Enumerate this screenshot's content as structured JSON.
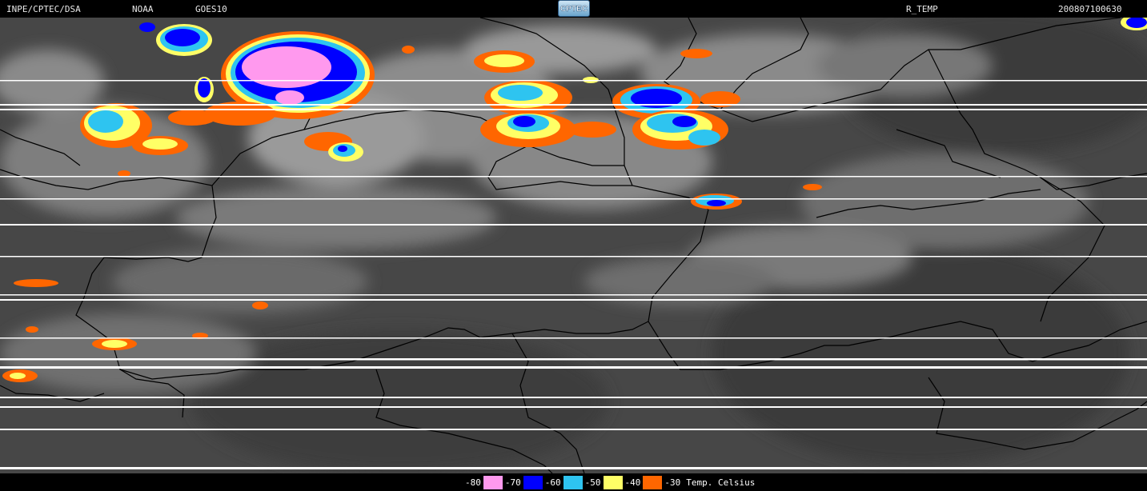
{
  "header": {
    "source": "INPE/CPTEC/DSA",
    "agency": "NOAA",
    "satellite": "GOES10",
    "logo_text": "CPTEC",
    "product": "R_TEMP",
    "timestamp": "200807100630"
  },
  "legend": {
    "items": [
      {
        "value": "-80",
        "color": "#ff99ee"
      },
      {
        "value": "-70",
        "color": "#0000ff"
      },
      {
        "value": "-60",
        "color": "#2ec4f0"
      },
      {
        "value": "-50",
        "color": "#ffff66"
      },
      {
        "value": "-40",
        "color": "#ff6600"
      },
      {
        "value": "-30",
        "color": ""
      }
    ],
    "unit_label": "Temp. Celsius"
  },
  "colors": {
    "background": "#474747",
    "border_lines": "#000000",
    "scan_lines": "#ffffff",
    "cloud_gray": "#a8a8a8"
  }
}
